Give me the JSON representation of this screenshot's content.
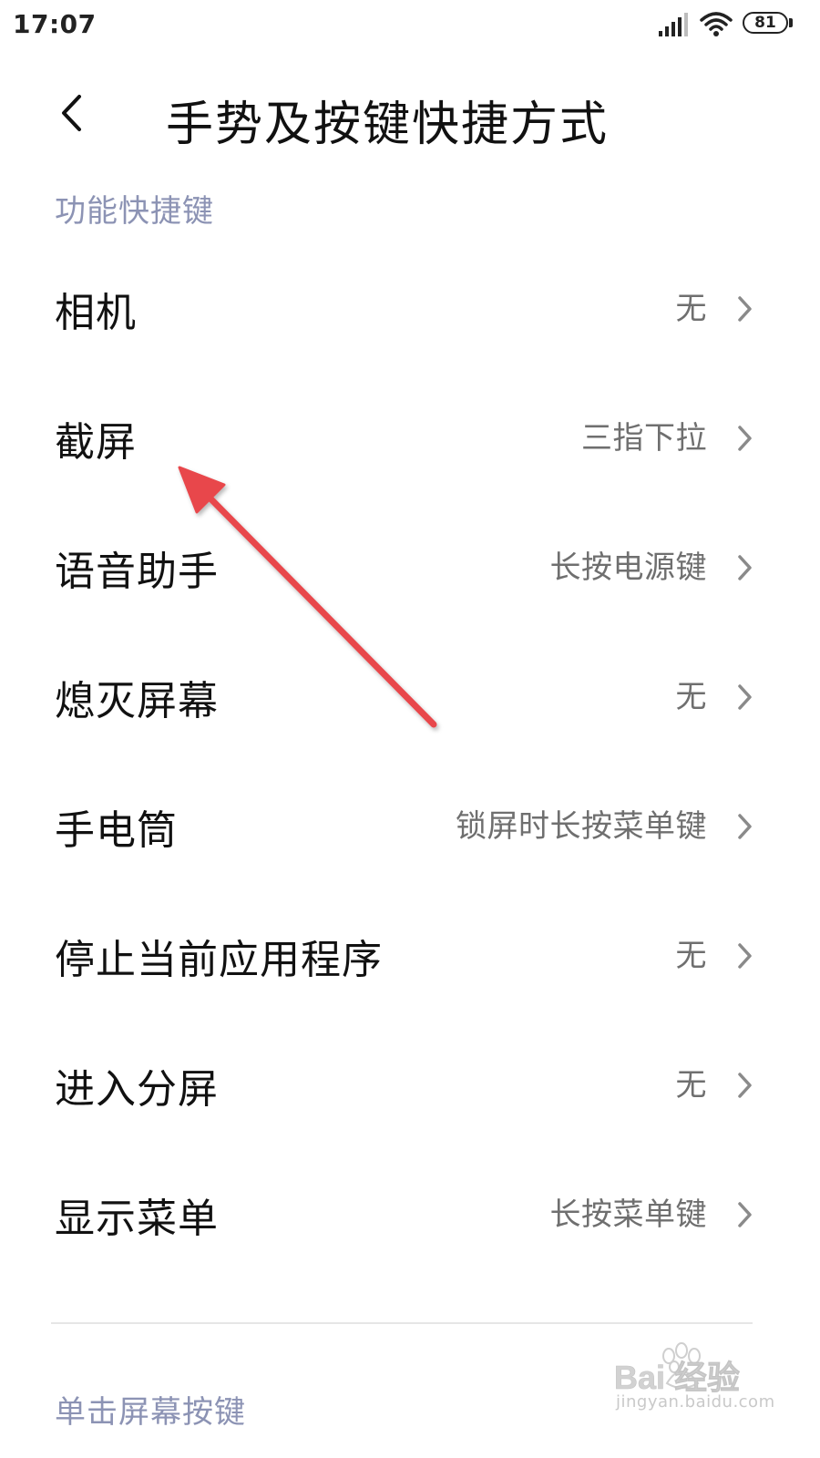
{
  "status_bar": {
    "time": "17:07",
    "battery": "81"
  },
  "header": {
    "title": "手势及按键快捷方式"
  },
  "sections": [
    {
      "title": "功能快捷键",
      "items": [
        {
          "label": "相机",
          "value": "无"
        },
        {
          "label": "截屏",
          "value": "三指下拉"
        },
        {
          "label": "语音助手",
          "value": "长按电源键"
        },
        {
          "label": "熄灭屏幕",
          "value": "无"
        },
        {
          "label": "手电筒",
          "value": "锁屏时长按菜单键"
        },
        {
          "label": "停止当前应用程序",
          "value": "无"
        },
        {
          "label": "进入分屏",
          "value": "无"
        },
        {
          "label": "显示菜单",
          "value": "长按菜单键"
        }
      ]
    },
    {
      "title": "单击屏幕按键"
    }
  ],
  "watermark": {
    "logo": "Bai 经验",
    "url": "jingyan.baidu.com"
  },
  "colors": {
    "section_header": "#8c93b4",
    "annotation_arrow": "#e8474b",
    "value_text": "#6f6f6f"
  },
  "icons": [
    "signal-icon",
    "wifi-icon",
    "battery-icon",
    "back-arrow-icon",
    "chevron-right-icon",
    "annotation-arrow"
  ]
}
